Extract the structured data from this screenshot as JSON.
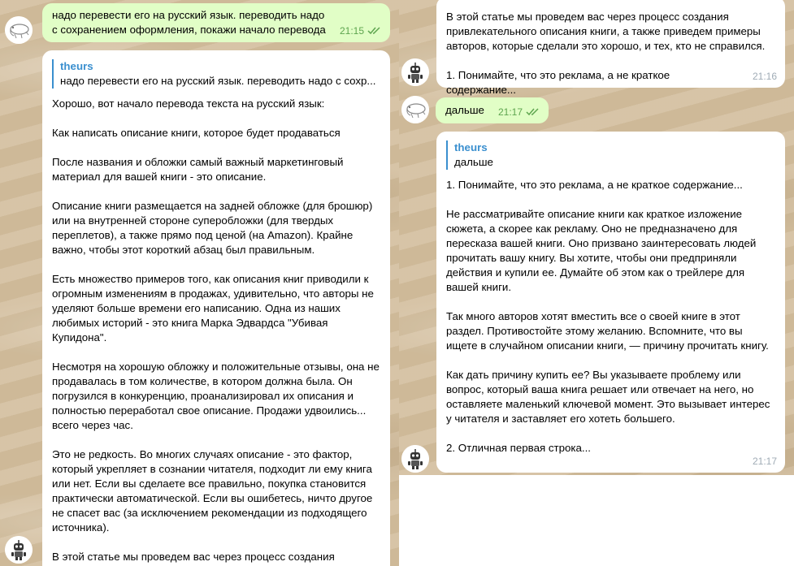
{
  "left": {
    "outgoing": {
      "text": "надо перевести его на русский язык. переводить надо с сохранением оформления, покажи начало перевода",
      "time": "21:15"
    },
    "reply_block": {
      "author": "theurs",
      "quote": "надо перевести его на русский язык. переводить надо с сохр..."
    },
    "paragraphs": [
      "Хорошо, вот начало перевода текста на русский язык:",
      "Как написать описание книги, которое будет продаваться",
      "После названия и обложки самый важный маркетинговый материал для вашей книги - это описание.",
      "Описание книги размещается на задней обложке (для брошюр) или на внутренней стороне суперобложки (для твердых переплетов), а также прямо под ценой (на Amazon). Крайне важно, чтобы этот короткий абзац был правильным.",
      "Есть множество примеров того, как описания книг приводили к огромным изменениям в продажах, удивительно, что авторы не уделяют больше времени его написанию. Одна из наших любимых историй - это книга Марка Эдвардса \"Убивая Купидона\".",
      "Несмотря на хорошую обложку и положительные отзывы, она не продавалась в том количестве, в котором должна была. Он погрузился в конкуренцию, проанализировал их описания и полностью переработал свое описание. Продажи удвоились... всего через час.",
      "Это не редкость. Во многих случаях описание - это фактор, который укрепляет в сознании читателя, подходит ли ему книга или нет. Если вы сделаете все правильно, покупка становится практически автоматической. Если вы ошибетесь, ничто другое не спасет вас (за исключением рекомендации из подходящего источника).",
      "В этой статье мы проведем вас через процесс создания"
    ]
  },
  "right": {
    "first_bubble": {
      "paragraphs": [
        "В этой статье мы проведем вас через процесс создания привлекательного описания книги, а также приведем примеры авторов, которые сделали это хорошо, и тех, кто не справился.",
        "1. Понимайте, что это реклама, а не краткое содержание..."
      ],
      "time": "21:16"
    },
    "outgoing": {
      "text": "дальше",
      "time": "21:17"
    },
    "second_bubble": {
      "reply_author": "theurs",
      "reply_quote": "дальше",
      "paragraphs": [
        "1. Понимайте, что это реклама, а не краткое содержание...",
        "Не рассматривайте описание книги как краткое изложение сюжета, а скорее как рекламу. Оно не предназначено для пересказа вашей книги. Оно призвано заинтересовать людей прочитать вашу книгу. Вы хотите, чтобы они предприняли действия и купили ее. Думайте об этом как о трейлере для вашей книги.",
        "Так много авторов хотят вместить все о своей книге в этот раздел. Противостойте этому желанию. Вспомните, что вы ищете в случайном описании книги, — причину прочитать книгу.",
        "Как дать причину купить ее? Вы указываете проблему или вопрос, который ваша книга решает или отвечает на него, но оставляете маленький ключевой момент. Это вызывает интерес у читателя и заставляет его хотеть большего.",
        "2. Отличная первая строка..."
      ],
      "time": "21:17"
    }
  },
  "icons": {
    "user_avatar": "sketch-avatar-icon",
    "bot_avatar": "robot-avatar-icon",
    "read_receipt": "double-check-icon"
  },
  "colors": {
    "outgoing_bubble": "#e1fec6",
    "incoming_bubble": "#ffffff",
    "accent": "#3a8fcf",
    "check": "#5ea54f"
  }
}
